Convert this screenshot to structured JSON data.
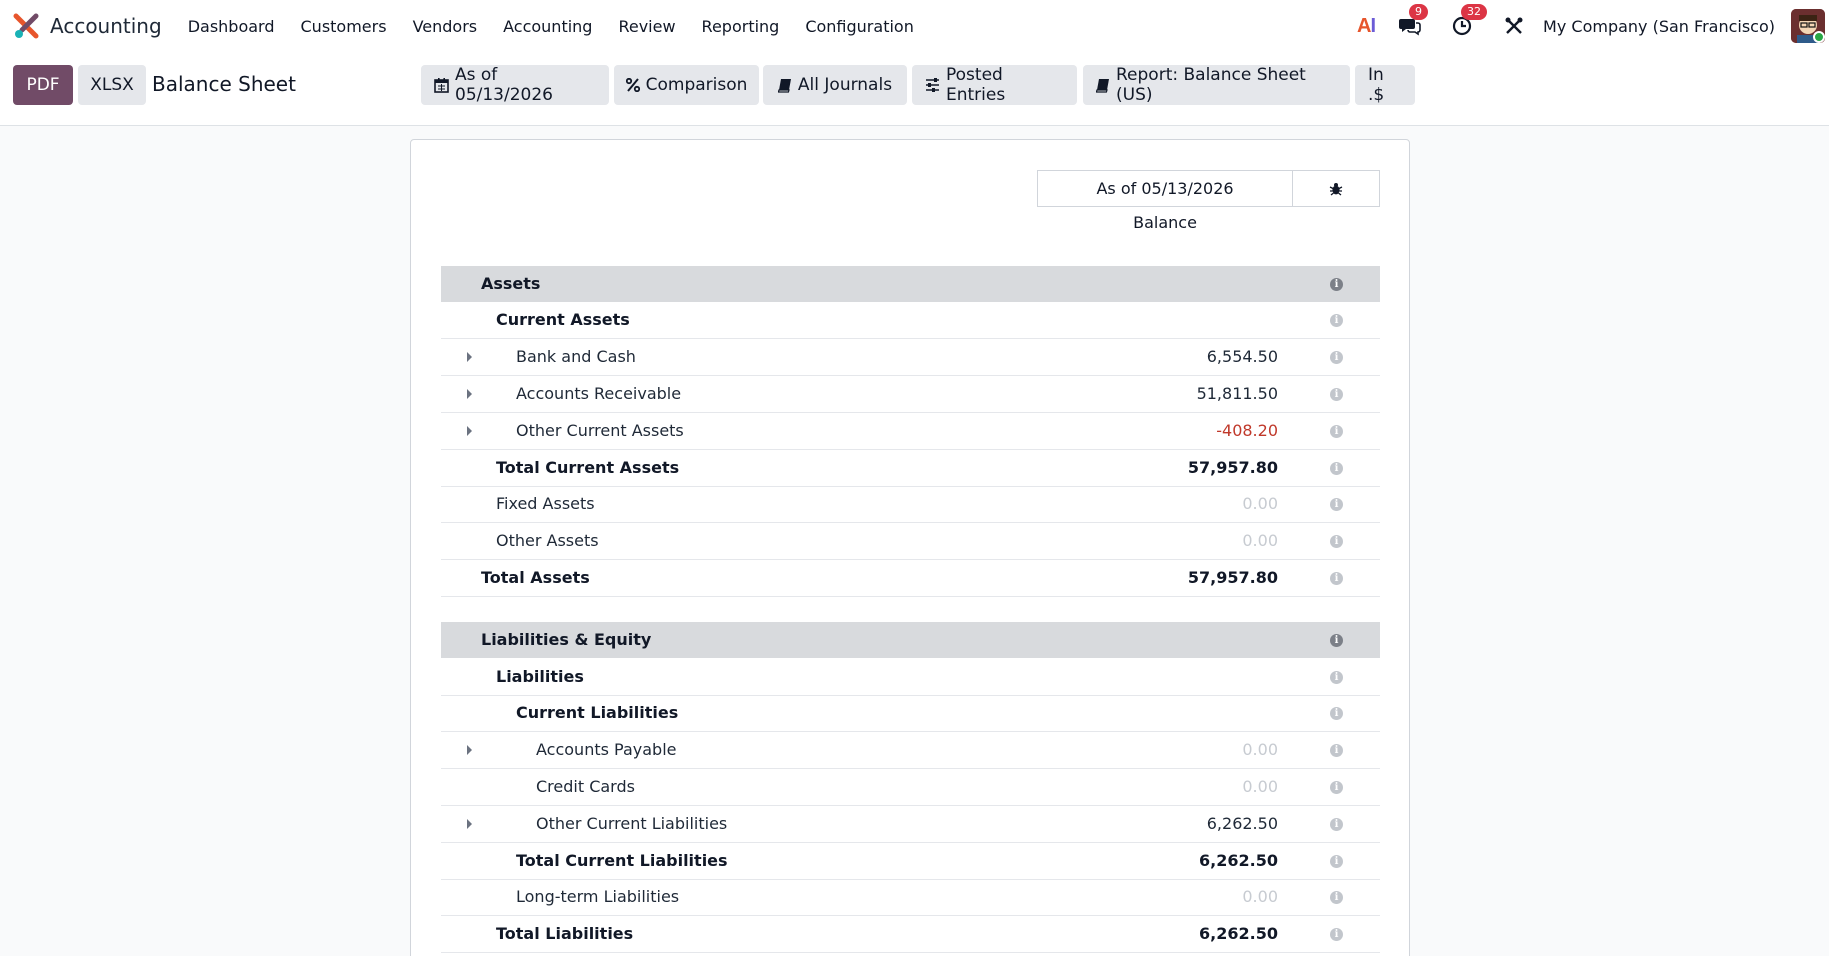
{
  "navbar": {
    "app_name": "Accounting",
    "menu": [
      "Dashboard",
      "Customers",
      "Vendors",
      "Accounting",
      "Review",
      "Reporting",
      "Configuration"
    ],
    "ai_label_a": "A",
    "ai_label_i": "I",
    "messages_count": "9",
    "activities_count": "32",
    "company": "My Company (San Francisco)"
  },
  "control": {
    "pdf_label": "PDF",
    "xlsx_label": "XLSX",
    "title": "Balance Sheet",
    "filters": {
      "date": "As of 05/13/2026",
      "comparison": "Comparison",
      "journals": "All Journals",
      "entries": "Posted Entries",
      "report": "Report: Balance Sheet (US)",
      "currency": "In .$"
    }
  },
  "report": {
    "column_header": "As of 05/13/2026",
    "column_subheader": "Balance",
    "info_glyph": "i",
    "rows": [
      {
        "label": "Assets",
        "value": ""
      },
      {
        "label": "Current Assets",
        "value": ""
      },
      {
        "label": "Bank and Cash",
        "value": "6,554.50"
      },
      {
        "label": "Accounts Receivable",
        "value": "51,811.50"
      },
      {
        "label": "Other Current Assets",
        "value": "-408.20"
      },
      {
        "label": "Total Current Assets",
        "value": "57,957.80"
      },
      {
        "label": "Fixed Assets",
        "value": "0.00"
      },
      {
        "label": "Other Assets",
        "value": "0.00"
      },
      {
        "label": "Total Assets",
        "value": "57,957.80"
      },
      {
        "label": "Liabilities & Equity",
        "value": ""
      },
      {
        "label": "Liabilities",
        "value": ""
      },
      {
        "label": "Current Liabilities",
        "value": ""
      },
      {
        "label": "Accounts Payable",
        "value": "0.00"
      },
      {
        "label": "Credit Cards",
        "value": "0.00"
      },
      {
        "label": "Other Current Liabilities",
        "value": "6,262.50"
      },
      {
        "label": "Total Current Liabilities",
        "value": "6,262.50"
      },
      {
        "label": "Long-term Liabilities",
        "value": "0.00"
      },
      {
        "label": "Total Liabilities",
        "value": "6,262.50"
      }
    ]
  },
  "colors": {
    "primary": "#714b67",
    "badge": "#dc3545",
    "negative": "#c0392b",
    "section_header_bg": "#d8dadd"
  }
}
